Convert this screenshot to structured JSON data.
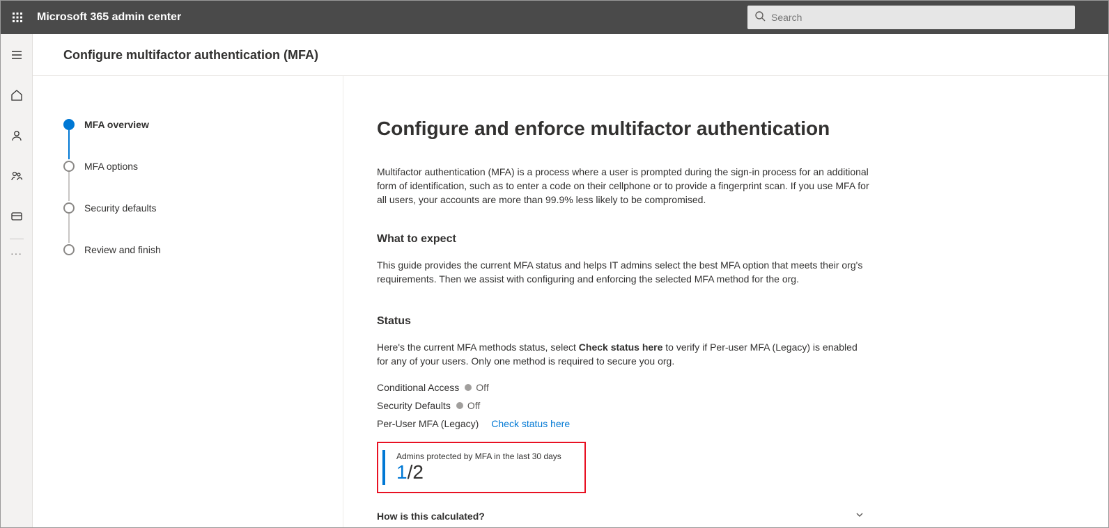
{
  "header": {
    "app_title": "Microsoft 365 admin center",
    "search_placeholder": "Search"
  },
  "page": {
    "title": "Configure multifactor authentication (MFA)"
  },
  "steps": [
    {
      "label": "MFA overview"
    },
    {
      "label": "MFA options"
    },
    {
      "label": "Security defaults"
    },
    {
      "label": "Review and finish"
    }
  ],
  "main": {
    "heading": "Configure and enforce multifactor authentication",
    "intro": "Multifactor authentication (MFA) is a process where a user is prompted during the sign-in process for an additional form of identification, such as to enter a code on their cellphone or to provide a fingerprint scan. If you use MFA for all users, your accounts are more than 99.9% less likely to be compromised.",
    "expect_heading": "What to expect",
    "expect_text": "This guide provides the current MFA status and helps IT admins select the best MFA option that meets their org's requirements. Then we assist with configuring and enforcing the selected MFA method for the org.",
    "status_heading": "Status",
    "status_intro_pre": "Here's the current MFA methods status, select ",
    "status_intro_bold": "Check status here",
    "status_intro_post": " to verify if Per-user MFA (Legacy) is enabled for any of your users. Only one method is required to secure you org.",
    "status_rows": {
      "conditional_label": "Conditional Access",
      "conditional_value": "Off",
      "defaults_label": "Security Defaults",
      "defaults_value": "Off",
      "peruser_label": "Per-User MFA (Legacy)",
      "peruser_link": "Check status here"
    },
    "card": {
      "title": "Admins protected by MFA in the last 30 days",
      "numerator": "1",
      "slash": "/",
      "denominator": "2"
    },
    "calc_label": "How is this calculated?"
  }
}
